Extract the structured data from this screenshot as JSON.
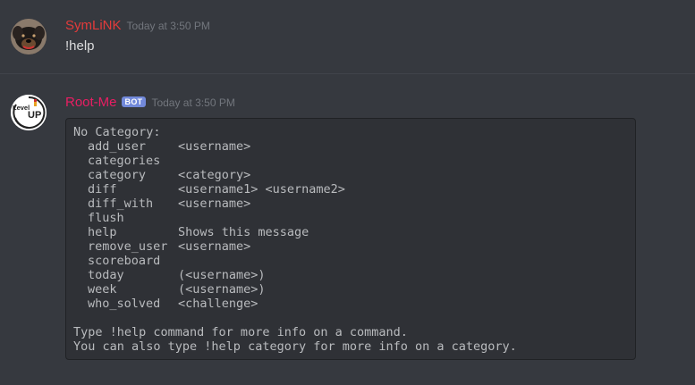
{
  "messages": [
    {
      "username": "SymLiNK",
      "username_color": "#e33b3b",
      "timestamp": "Today at 3:50 PM",
      "text": "!help",
      "avatar_icon": "rottweiler-dog-avatar"
    },
    {
      "username": "Root-Me",
      "username_color": "#e91e63",
      "timestamp": "Today at 3:50 PM",
      "bot_tag": "BOT",
      "avatar_icon": "level-up-logo-avatar",
      "avatar_text_1": "Level",
      "avatar_text_2": "UP",
      "code": {
        "heading": "No Category:",
        "commands": [
          {
            "name": "add_user",
            "args": "<username>"
          },
          {
            "name": "categories",
            "args": ""
          },
          {
            "name": "category",
            "args": "<category>"
          },
          {
            "name": "diff",
            "args": "<username1> <username2>"
          },
          {
            "name": "diff_with",
            "args": "<username>"
          },
          {
            "name": "flush",
            "args": ""
          },
          {
            "name": "help",
            "args": "Shows this message"
          },
          {
            "name": "remove_user",
            "args": "<username>"
          },
          {
            "name": "scoreboard",
            "args": ""
          },
          {
            "name": "today",
            "args": "(<username>)"
          },
          {
            "name": "week",
            "args": "(<username>)"
          },
          {
            "name": "who_solved",
            "args": "<challenge>"
          }
        ],
        "footer_1": "Type !help command for more info on a command.",
        "footer_2": "You can also type !help category for more info on a category."
      }
    }
  ]
}
